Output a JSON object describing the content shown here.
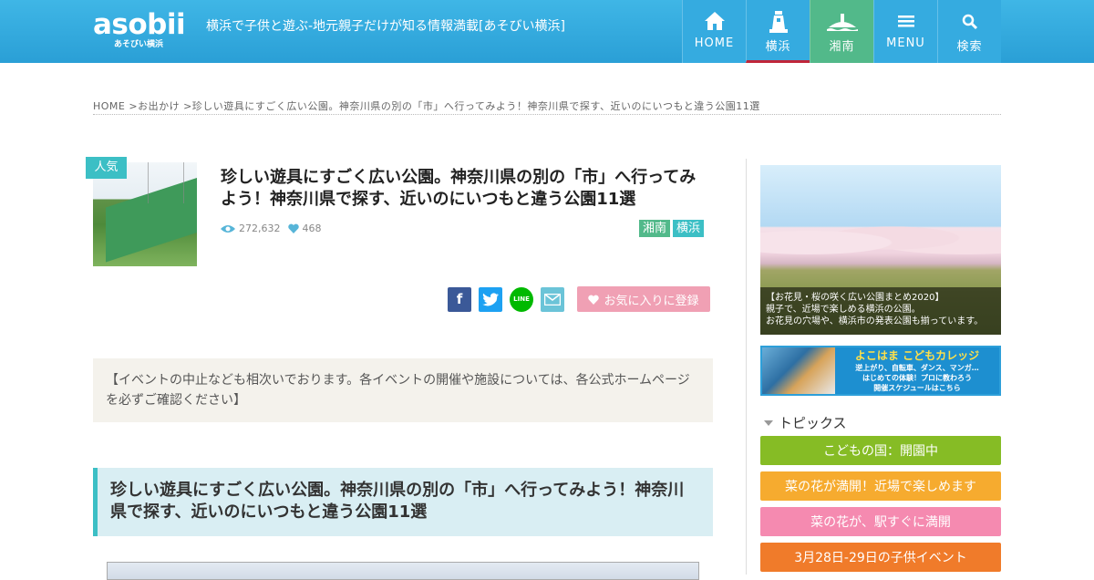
{
  "header": {
    "logo_text": "asobii",
    "logo_sub": "あそびい横浜",
    "tagline": "横浜で子供と遊ぶ-地元親子だけが知る情報満載[あそびい横浜]",
    "nav": [
      {
        "label": "HOME",
        "icon": "home-icon"
      },
      {
        "label": "横浜",
        "icon": "lighthouse-icon"
      },
      {
        "label": "湘南",
        "icon": "island-icon"
      },
      {
        "label": "MENU",
        "icon": "menu-icon"
      },
      {
        "label": "検索",
        "icon": "search-icon"
      }
    ]
  },
  "breadcrumb": "HOME >お出かけ >珍しい遊具にすごく広い公園。神奈川県の別の「市」へ行ってみよう！神奈川県で探す、近いのにいつもと違う公園11選",
  "article": {
    "badge": "人気",
    "title": "珍しい遊具にすごく広い公園。神奈川県の別の「市」へ行ってみよう！神奈川県で探す、近いのにいつもと違う公園11選",
    "views": "272,632",
    "likes": "468",
    "tags": [
      "湘南",
      "横浜"
    ],
    "favorite_label": "お気に入りに登録",
    "notice": "【イベントの中止なども相次いでおります。各イベントの開催や施設については、各公式ホームページを必ずご確認ください】",
    "section_heading": "珍しい遊具にすごく広い公園。神奈川県の別の「市」へ行ってみよう！神奈川県で探す、近いのにいつもと違う公園11選"
  },
  "share": {
    "facebook": "f",
    "line": "LINE"
  },
  "sidebar": {
    "banner1_caption": [
      "【お花見・桜の咲く広い公園まとめ2020】",
      "親子で、近場で楽しめる横浜の公園。",
      "お花見の穴場や、横浜市の発表公園も揃っています。"
    ],
    "banner2": {
      "title": "よこはま こどもカレッジ",
      "lines": [
        "逆上がり、自転車、ダンス、マンガ…",
        "はじめての体験！プロに教わろう",
        "開催スケジュールはこちら"
      ]
    },
    "topics_label": "トピックス",
    "topics": [
      {
        "label": "こどもの国：開園中",
        "color": "#86bc25"
      },
      {
        "label": "菜の花が満開！近場で楽しめます",
        "color": "#f6ab2f"
      },
      {
        "label": "菜の花が、駅すぐに満開",
        "color": "#f58ab0"
      },
      {
        "label": "3月28日-29日の子供イベント",
        "color": "#f07b2a"
      }
    ]
  },
  "colors": {
    "header": "#35abe0",
    "shonan": "#52b98a",
    "accent": "#3cbfc5",
    "favorite": "#f0a0b4"
  }
}
